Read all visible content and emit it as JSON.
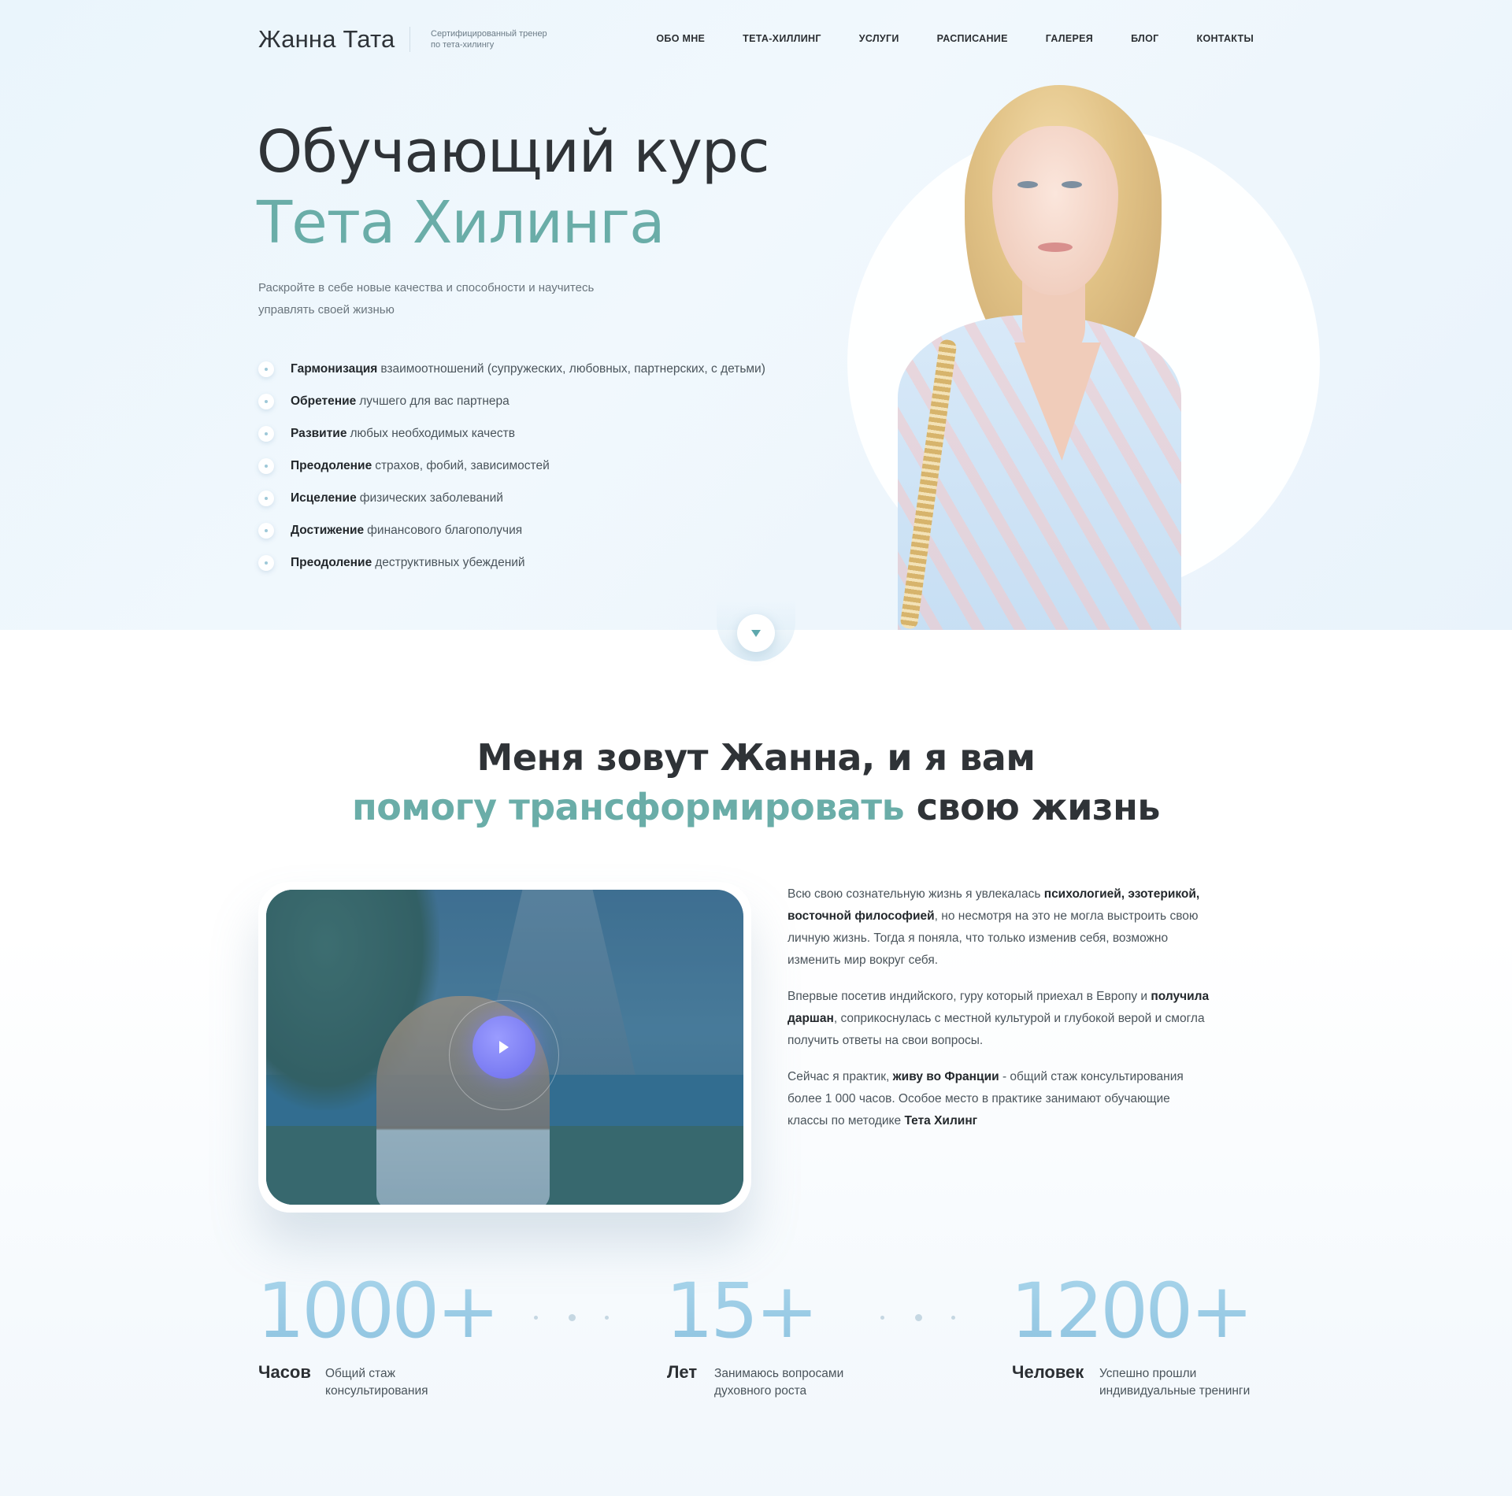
{
  "header": {
    "logo": "Жанна Тата",
    "logo_subtitle": "Сертифицированный тренер по тета-хилингу",
    "nav": [
      "ОБО МНЕ",
      "ТЕТА-ХИЛЛИНГ",
      "УСЛУГИ",
      "РАСПИСАНИЕ",
      "ГАЛЕРЕЯ",
      "БЛОГ",
      "КОНТАКТЫ"
    ]
  },
  "hero": {
    "title_line1": "Обучающий курс",
    "title_line2": "Тета Хилинга",
    "subtitle": "Раскройте в себе новые качества и способности и научитесь управлять своей жизнью",
    "bullets": [
      {
        "bold": "Гармонизация",
        "text": "взаимоотношений (супружеских, любовных, партнерских, с детьми)"
      },
      {
        "bold": "Обретение",
        "text": "лучшего для вас партнера"
      },
      {
        "bold": "Развитие",
        "text": "любых необходимых качеств"
      },
      {
        "bold": "Преодоление",
        "text": "страхов, фобий, зависимостей"
      },
      {
        "bold": "Исцеление",
        "text": "физических заболеваний"
      },
      {
        "bold": "Достижение",
        "text": "финансового благополучия"
      },
      {
        "bold": "Преодоление",
        "text": "деструктивных убеждений"
      }
    ]
  },
  "about": {
    "title_line1": "Меня зовут Жанна, и я вам",
    "title_accent": "помогу трансформировать",
    "title_rest": "свою жизнь",
    "p1": {
      "t1": "Всю свою сознательную жизнь я увлекалась",
      "b1": "психологией, эзотерикой, восточной философией",
      "t2": ", но несмотря на это не могла выстроить свою личную жизнь. Тогда я поняла, что только изменив себя, возможно изменить мир вокруг себя."
    },
    "p2": {
      "t1": "Впервые посетив индийского, гуру который приехал в Европу и",
      "b1": "получила даршан",
      "t2": ", соприкоснулась с местной культурой и глубокой верой и смогла получить ответы на свои вопросы."
    },
    "p3": {
      "t1": "Сейчас я практик,",
      "b1": "живу во Франции",
      "t2": "- общий стаж консультирования более 1 000 часов.  Особое место в практике занимают обучающие классы  по методике",
      "b2": "Тета Хилинг"
    }
  },
  "stats": [
    {
      "number": "1000+",
      "label": "Часов",
      "desc": "Общий стаж консультирования"
    },
    {
      "number": "15+",
      "label": "Лет",
      "desc": "Занимаюсь вопросами духовного роста"
    },
    {
      "number": "1200+",
      "label": "Человек",
      "desc": "Успешно прошли индивидуальные тренинги"
    }
  ],
  "colors": {
    "accent": "#6aada8",
    "play": "#7a7bf2",
    "stat_number": "#8ec3e0"
  }
}
